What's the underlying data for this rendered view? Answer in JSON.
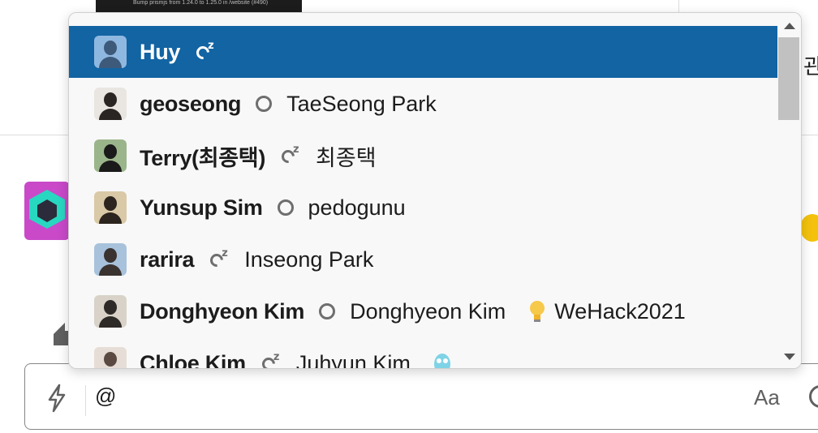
{
  "background": {
    "thumb_text": "Bump prismjs from 1.24.0 to 1.25.0 in /website (#490)",
    "korean_fragment": "관"
  },
  "dropdown": {
    "items": [
      {
        "name": "Huy",
        "status": "dnd",
        "realname": "",
        "emoji": "",
        "custom_status": "",
        "active": true,
        "avatar_bg": "#8fb8e0",
        "avatar_fg": "#3d5a7a"
      },
      {
        "name": "geoseong",
        "status": "away",
        "realname": "TaeSeong Park",
        "emoji": "",
        "custom_status": "",
        "active": false,
        "avatar_bg": "#e9e5e0",
        "avatar_fg": "#2a2522"
      },
      {
        "name": "Terry(최종택)",
        "status": "dnd",
        "realname": "최종택",
        "emoji": "",
        "custom_status": "",
        "active": false,
        "avatar_bg": "#9bb58a",
        "avatar_fg": "#1b1a1a"
      },
      {
        "name": "Yunsup Sim",
        "status": "away",
        "realname": "pedogunu",
        "emoji": "",
        "custom_status": "",
        "active": false,
        "avatar_bg": "#d9c9a6",
        "avatar_fg": "#2c241e"
      },
      {
        "name": "rarira",
        "status": "dnd",
        "realname": "Inseong Park",
        "emoji": "",
        "custom_status": "",
        "active": false,
        "avatar_bg": "#a8c2dc",
        "avatar_fg": "#3a3330"
      },
      {
        "name": "Donghyeon Kim",
        "status": "away",
        "realname": "Donghyeon Kim",
        "emoji": "lightbulb-icon",
        "custom_status": "WeHack2021",
        "active": false,
        "avatar_bg": "#d8d2c8",
        "avatar_fg": "#2e2a27"
      },
      {
        "name": "Chloe Kim",
        "status": "dnd",
        "realname": "Juhyun Kim",
        "emoji": "gopher-icon",
        "custom_status": "",
        "active": false,
        "avatar_bg": "#e6ddd6",
        "avatar_fg": "#5a4a42"
      }
    ]
  },
  "composer": {
    "value": "@",
    "format_label": "Aa"
  },
  "colors": {
    "active_row": "#1264a3",
    "status_icon": "#6e6e6e"
  }
}
